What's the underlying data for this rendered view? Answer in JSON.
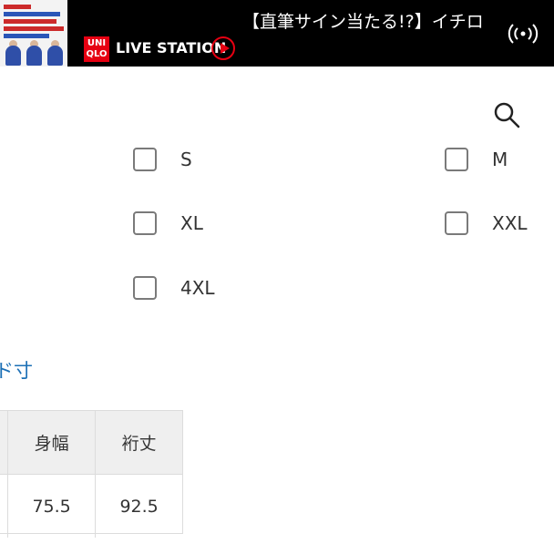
{
  "live_banner": {
    "ticker_text": "【直筆サイン当たる!?】イチロ",
    "brand_logo": [
      "UNI",
      "QLO"
    ],
    "title": "LIVE STATION",
    "icons": {
      "play": "play-circle-icon",
      "broadcast": "broadcast-icon"
    },
    "colors": {
      "brand_red": "#e60012",
      "background": "#000000"
    }
  },
  "header": {
    "search_icon": "search-icon"
  },
  "size_filter": {
    "options": [
      {
        "label": "S",
        "checked": false
      },
      {
        "label": "M",
        "checked": false
      },
      {
        "label": "XL",
        "checked": false
      },
      {
        "label": "XXL",
        "checked": false
      },
      {
        "label": "4XL",
        "checked": false
      }
    ]
  },
  "size_link": {
    "text": "ド寸"
  },
  "size_table": {
    "headers": [
      "身幅",
      "裄丈"
    ],
    "rows": [
      [
        "75.5",
        "92.5"
      ]
    ],
    "colors": {
      "header_bg": "#efefef",
      "border": "#dcdcdc"
    }
  }
}
